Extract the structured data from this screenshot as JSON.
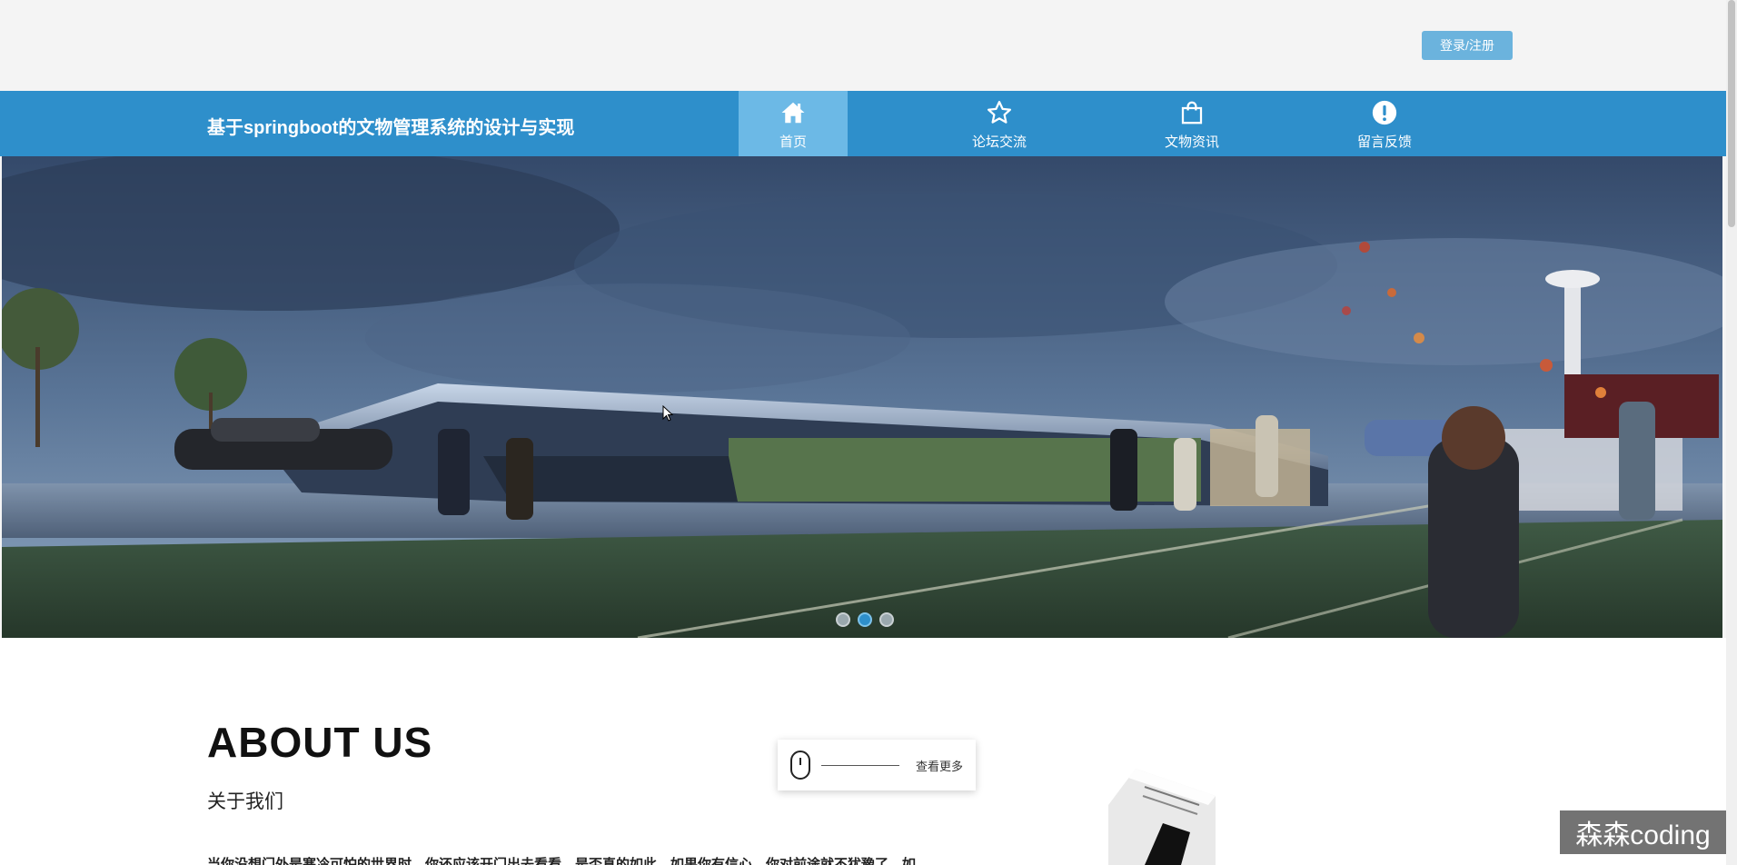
{
  "header": {
    "login_label": "登录/注册"
  },
  "nav": {
    "site_title": "基于springboot的文物管理系统的设计与实现",
    "items": [
      {
        "label": "首页",
        "icon": "home-icon",
        "active": true
      },
      {
        "label": "论坛交流",
        "icon": "star-icon",
        "active": false
      },
      {
        "label": "文物资讯",
        "icon": "shopping-bag-icon",
        "active": false
      },
      {
        "label": "留言反馈",
        "icon": "exclamation-circle-icon",
        "active": false
      }
    ],
    "color": "#2e8fcb",
    "active_color": "#6cb9e6"
  },
  "banner": {
    "slide_count": 3,
    "active_slide": 2
  },
  "about": {
    "title": "ABOUT US",
    "subtitle": "关于我们",
    "text": "当你没想门外是寒冷可怕的世界时，你还应该开门出去看看，是否真的如此。如果你有信心，你对前途就不犹豫了。如",
    "more_label": "查看更多"
  },
  "watermark": "森森coding"
}
